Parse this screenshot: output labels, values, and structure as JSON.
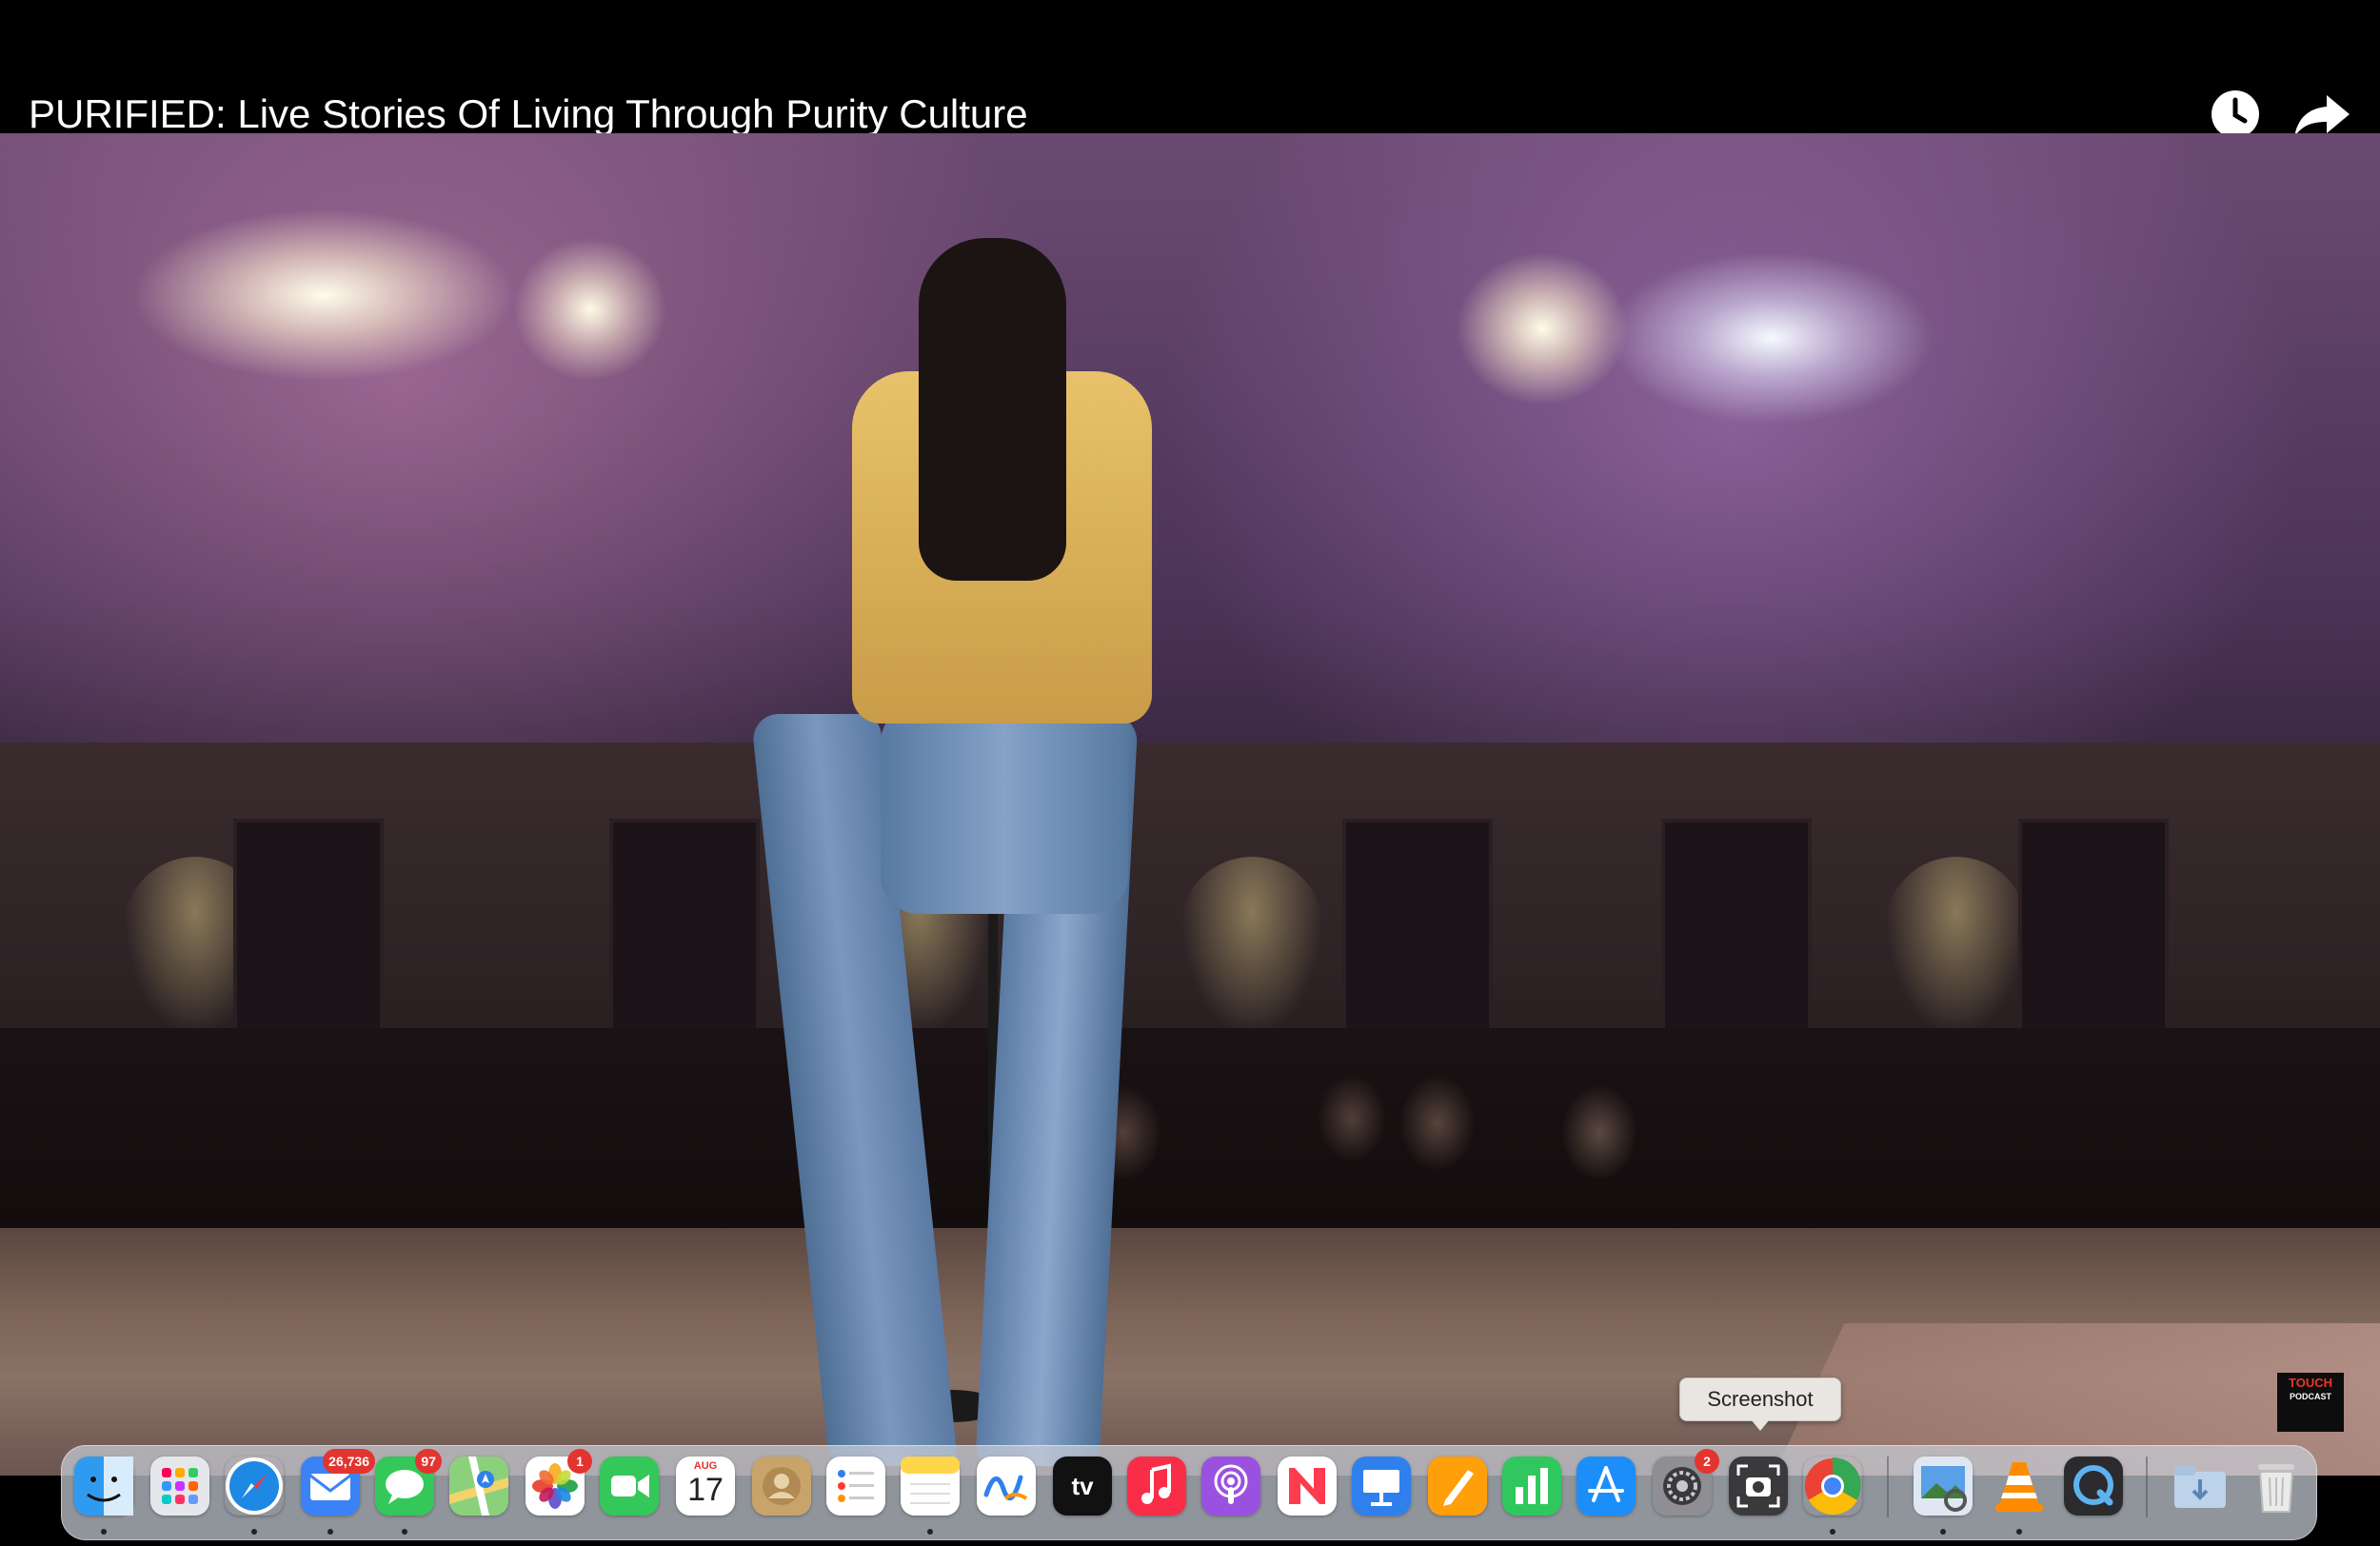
{
  "header": {
    "title": "PURIFIED: Live Stories Of Living Through Purity Culture",
    "watch_later_icon": "clock-icon",
    "share_icon": "share-arrow-icon"
  },
  "video": {
    "logo_line1": "TOUCH",
    "logo_line2": "PODCAST"
  },
  "tooltip": {
    "text": "Screenshot"
  },
  "dock": {
    "items": [
      {
        "name": "Finder",
        "icon": "finder-icon",
        "color": "#2f9bf0"
      },
      {
        "name": "Launchpad",
        "icon": "launchpad-icon",
        "color": "#e5e7eb"
      },
      {
        "name": "Safari",
        "icon": "safari-icon",
        "color": "#1e88e5"
      },
      {
        "name": "Mail",
        "icon": "mail-icon",
        "color": "#3b82f6",
        "badge": "26,736"
      },
      {
        "name": "Messages",
        "icon": "messages-icon",
        "color": "#34c759",
        "badge": "97"
      },
      {
        "name": "Maps",
        "icon": "maps-icon",
        "color": "#8bd17c"
      },
      {
        "name": "Photos",
        "icon": "photos-icon",
        "color": "#ffffff",
        "badge": "1"
      },
      {
        "name": "FaceTime",
        "icon": "facetime-icon",
        "color": "#34c759"
      },
      {
        "name": "Calendar",
        "icon": "calendar-icon",
        "color": "#ffffff",
        "month": "AUG",
        "day": "17"
      },
      {
        "name": "Contacts",
        "icon": "contacts-icon",
        "color": "#c8a46a"
      },
      {
        "name": "Reminders",
        "icon": "reminders-icon",
        "color": "#ffffff"
      },
      {
        "name": "Notes",
        "icon": "notes-icon",
        "color": "#ffd54a"
      },
      {
        "name": "Freeform",
        "icon": "freeform-icon",
        "color": "#ffffff"
      },
      {
        "name": "TV",
        "icon": "apple-tv-icon",
        "color": "#111111",
        "label": "tv"
      },
      {
        "name": "Music",
        "icon": "music-icon",
        "color": "#fa2d48"
      },
      {
        "name": "Podcasts",
        "icon": "podcasts-icon",
        "color": "#9b51e0"
      },
      {
        "name": "News",
        "icon": "news-icon",
        "color": "#ff3b4f"
      },
      {
        "name": "Keynote",
        "icon": "keynote-icon",
        "color": "#2f80ed"
      },
      {
        "name": "Pages",
        "icon": "pages-icon",
        "color": "#ff9f0a"
      },
      {
        "name": "Numbers",
        "icon": "numbers-icon",
        "color": "#30c85e"
      },
      {
        "name": "App Store",
        "icon": "app-store-icon",
        "color": "#1c8ef9"
      },
      {
        "name": "System Settings",
        "icon": "settings-gear-icon",
        "color": "#8e8e93",
        "badge": "2"
      },
      {
        "name": "Screenshot",
        "icon": "screenshot-icon",
        "color": "#3a3a3c"
      },
      {
        "name": "Chrome",
        "icon": "chrome-icon",
        "color": "#ffffff"
      },
      {
        "name": "Preview",
        "icon": "preview-icon",
        "color": "#5aa0e6"
      },
      {
        "name": "VLC",
        "icon": "vlc-cone-icon",
        "color": "#f0f0f0"
      },
      {
        "name": "QuickTime",
        "icon": "quicktime-icon",
        "color": "#2b2b2e"
      },
      {
        "name": "Downloads",
        "icon": "downloads-folder-icon",
        "color": "#bcd3ea"
      },
      {
        "name": "Trash",
        "icon": "trash-icon",
        "color": "#e6e6e6"
      }
    ]
  }
}
